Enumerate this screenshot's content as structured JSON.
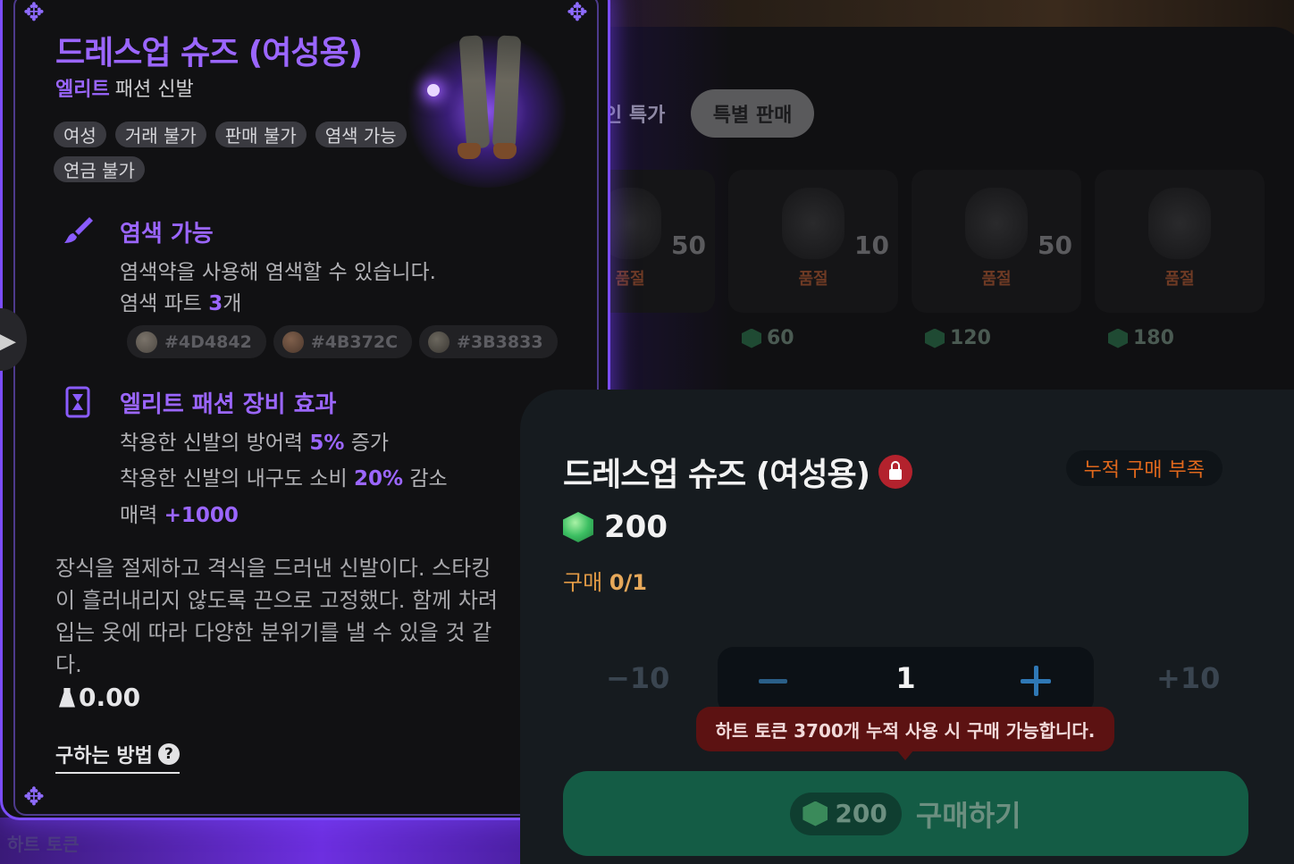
{
  "shop": {
    "tabs": [
      {
        "label": "할인 특가"
      },
      {
        "label": "특별 판매"
      }
    ],
    "items": [
      {
        "count": "50",
        "status": "품절",
        "price": ""
      },
      {
        "count": "10",
        "status": "품절",
        "price": "60"
      },
      {
        "count": "50",
        "status": "품절",
        "price": "120"
      },
      {
        "count": "",
        "status": "품절",
        "price": "180"
      }
    ],
    "token_label": "하트 토큰"
  },
  "tooltip": {
    "title": "드레스업 슈즈 (여성용)",
    "grade": "엘리트",
    "category": "패션 신발",
    "tags": [
      "여성",
      "거래 불가",
      "판매 불가",
      "염색 가능",
      "연금 불가"
    ],
    "dye_section": {
      "title": "염색 가능",
      "line1": "염색약을 사용해 염색할 수 있습니다.",
      "line2_prefix": "염색 파트 ",
      "line2_value": "3",
      "line2_suffix": "개",
      "colors": [
        {
          "label": "#4D4842",
          "color": "#4D4842"
        },
        {
          "label": "#4B372C",
          "color": "#4B372C"
        },
        {
          "label": "#3B3833",
          "color": "#3B3833"
        }
      ]
    },
    "effect_section": {
      "title": "엘리트 패션 장비 효과",
      "l1_prefix": "착용한 신발의 방어력 ",
      "l1_value": "5%",
      "l1_suffix": " 증가",
      "l2_prefix": "착용한 신발의 내구도 소비 ",
      "l2_value": "20%",
      "l2_suffix": " 감소",
      "l3_prefix": "매력 ",
      "l3_value": "+1000"
    },
    "description": "장식을 절제하고 격식을 드러낸 신발이다. 스타킹이 흘러내리지 않도록 끈으로 고정했다. 함께 차려입는 옷에 따라 다양한 분위기를 낼 수 있을 것 같다.",
    "weight": "0.00",
    "howto": "구하는 방법"
  },
  "purchase": {
    "title": "드레스업 슈즈 (여성용)",
    "warning_badge": "누적 구매 부족",
    "price": "200",
    "limit_label": "구매",
    "limit_value": "0/1",
    "minus10": "−10",
    "plus10": "+10",
    "quantity": "1",
    "notice": "하트 토큰 3700개 누적 사용 시 구매 가능합니다.",
    "buy_price": "200",
    "buy_label": "구매하기"
  },
  "colors": {
    "accent_purple": "#9b66ff",
    "buy_green": "#145c45",
    "warning_orange": "#e0681c",
    "notice_red": "#5c1212"
  }
}
